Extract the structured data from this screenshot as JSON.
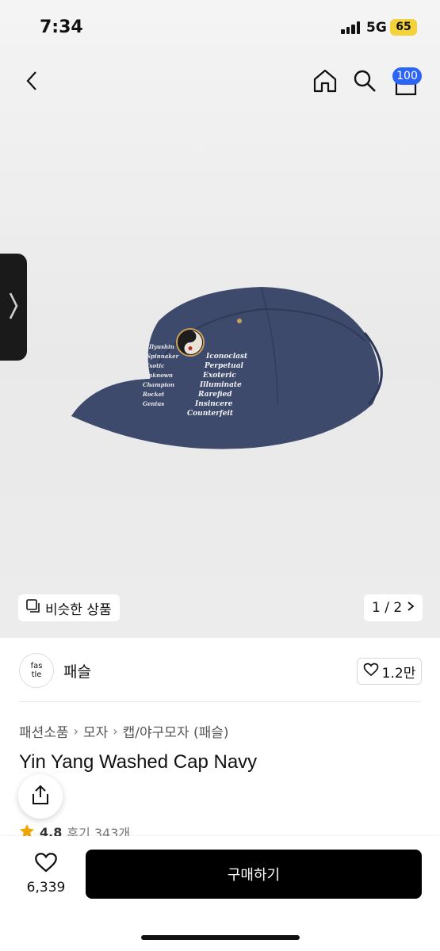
{
  "status_bar": {
    "time": "7:34",
    "network": "5G",
    "battery": "65"
  },
  "nav": {
    "cart_count": "100"
  },
  "gallery": {
    "similar_label": "비슷한 상품",
    "page_indicator": "1 / 2",
    "cap_text_left": [
      "Ilyushin",
      "Spinnaker",
      "Exotic",
      "Unknown",
      "Champion",
      "Rocket",
      "Genius"
    ],
    "cap_text_right": [
      "Iconoclast",
      "Perpetual",
      "Exoteric",
      "Illuminate",
      "Rarefied",
      "Insincere",
      "Counterfeit"
    ]
  },
  "brand": {
    "logo_line1": "fas",
    "logo_line2": "tle",
    "name": "패슬",
    "likes": "1.2만"
  },
  "breadcrumb": [
    "패션소품",
    "모자",
    "캡/야구모자 (패슬)"
  ],
  "product": {
    "title": "Yin Yang Washed Cap Navy",
    "rating": "4.8",
    "reviews": "후기 343개"
  },
  "bottom": {
    "wish_count": "6,339",
    "buy_label": "구매하기"
  },
  "colors": {
    "accent": "#2c64f5",
    "star": "#f0a500",
    "cap": "#3a4666"
  }
}
